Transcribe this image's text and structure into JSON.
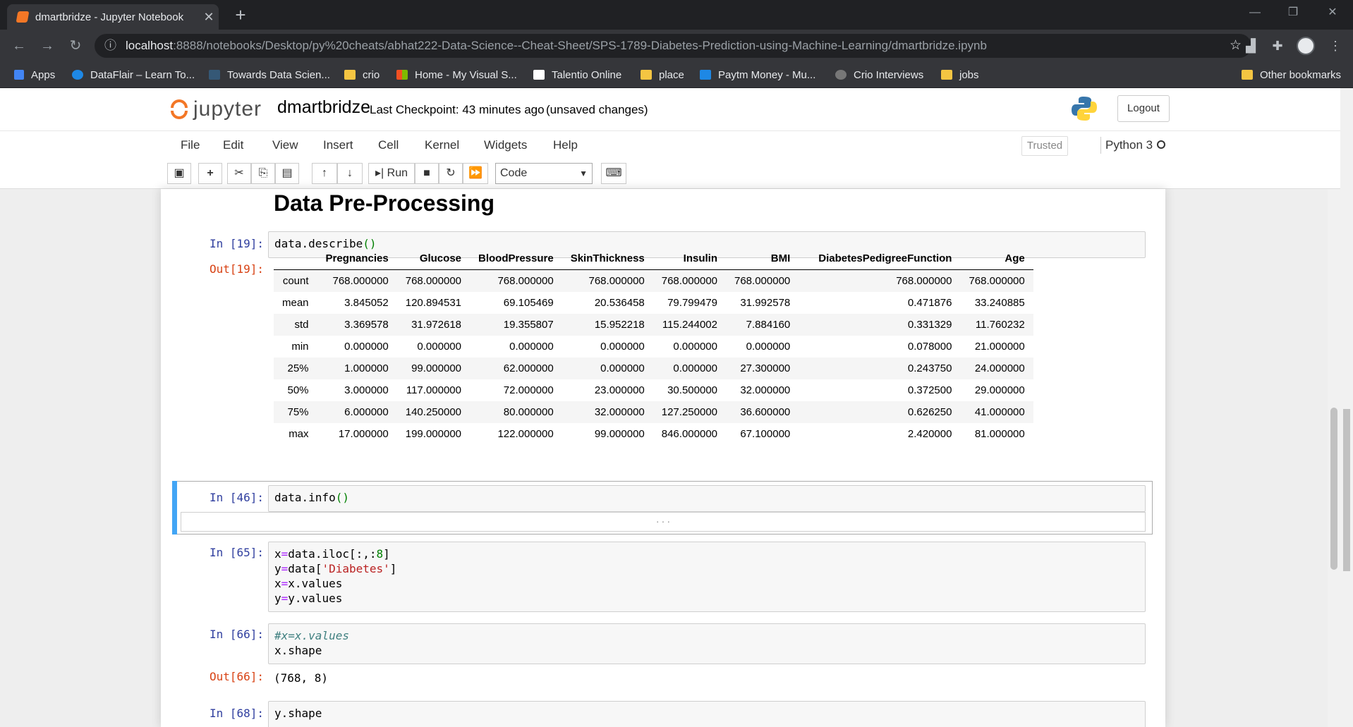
{
  "browser": {
    "tab_title": "dmartbridze - Jupyter Notebook",
    "url_host": "localhost",
    "url_rest": ":8888/notebooks/Desktop/py%20cheats/abhat222-Data-Science--Cheat-Sheet/SPS-1789-Diabetes-Prediction-using-Machine-Learning/dmartbridze.ipynb",
    "bookmarks": [
      "Apps",
      "DataFlair – Learn To...",
      "Towards Data Scien...",
      "crio",
      "Home - My Visual S...",
      "Talentio Online",
      "place",
      "Paytm Money - Mu...",
      "Crio Interviews",
      "jobs"
    ],
    "other_bookmarks": "Other bookmarks"
  },
  "header": {
    "logo_text": "jupyter",
    "notebook_name": "dmartbridze",
    "checkpoint": "Last Checkpoint: 43 minutes ago",
    "unsaved": "(unsaved changes)",
    "logout": "Logout"
  },
  "menu": {
    "items": [
      "File",
      "Edit",
      "View",
      "Insert",
      "Cell",
      "Kernel",
      "Widgets",
      "Help"
    ],
    "trusted": "Trusted",
    "kernel": "Python 3"
  },
  "toolbar": {
    "run": "Run",
    "cell_type": "Code"
  },
  "notebook": {
    "heading": "Data Pre-Processing",
    "cells": {
      "c19": {
        "in": "In [19]:",
        "out": "Out[19]:"
      },
      "c46": {
        "in": "In [46]:",
        "collapsed": ". . ."
      },
      "c65": {
        "in": "In [65]:"
      },
      "c66": {
        "in": "In [66]:",
        "out": "Out[66]:",
        "output": "(768, 8)"
      },
      "c68": {
        "in": "In [68]:"
      }
    },
    "describe": {
      "columns": [
        "Pregnancies",
        "Glucose",
        "BloodPressure",
        "SkinThickness",
        "Insulin",
        "BMI",
        "DiabetesPedigreeFunction",
        "Age"
      ],
      "rows": [
        {
          "label": "count",
          "values": [
            "768.000000",
            "768.000000",
            "768.000000",
            "768.000000",
            "768.000000",
            "768.000000",
            "768.000000",
            "768.000000"
          ]
        },
        {
          "label": "mean",
          "values": [
            "3.845052",
            "120.894531",
            "69.105469",
            "20.536458",
            "79.799479",
            "31.992578",
            "0.471876",
            "33.240885"
          ]
        },
        {
          "label": "std",
          "values": [
            "3.369578",
            "31.972618",
            "19.355807",
            "15.952218",
            "115.244002",
            "7.884160",
            "0.331329",
            "11.760232"
          ]
        },
        {
          "label": "min",
          "values": [
            "0.000000",
            "0.000000",
            "0.000000",
            "0.000000",
            "0.000000",
            "0.000000",
            "0.078000",
            "21.000000"
          ]
        },
        {
          "label": "25%",
          "values": [
            "1.000000",
            "99.000000",
            "62.000000",
            "0.000000",
            "0.000000",
            "27.300000",
            "0.243750",
            "24.000000"
          ]
        },
        {
          "label": "50%",
          "values": [
            "3.000000",
            "117.000000",
            "72.000000",
            "23.000000",
            "30.500000",
            "32.000000",
            "0.372500",
            "29.000000"
          ]
        },
        {
          "label": "75%",
          "values": [
            "6.000000",
            "140.250000",
            "80.000000",
            "32.000000",
            "127.250000",
            "36.600000",
            "0.626250",
            "41.000000"
          ]
        },
        {
          "label": "max",
          "values": [
            "17.000000",
            "199.000000",
            "122.000000",
            "99.000000",
            "846.000000",
            "67.100000",
            "2.420000",
            "81.000000"
          ]
        }
      ]
    }
  }
}
